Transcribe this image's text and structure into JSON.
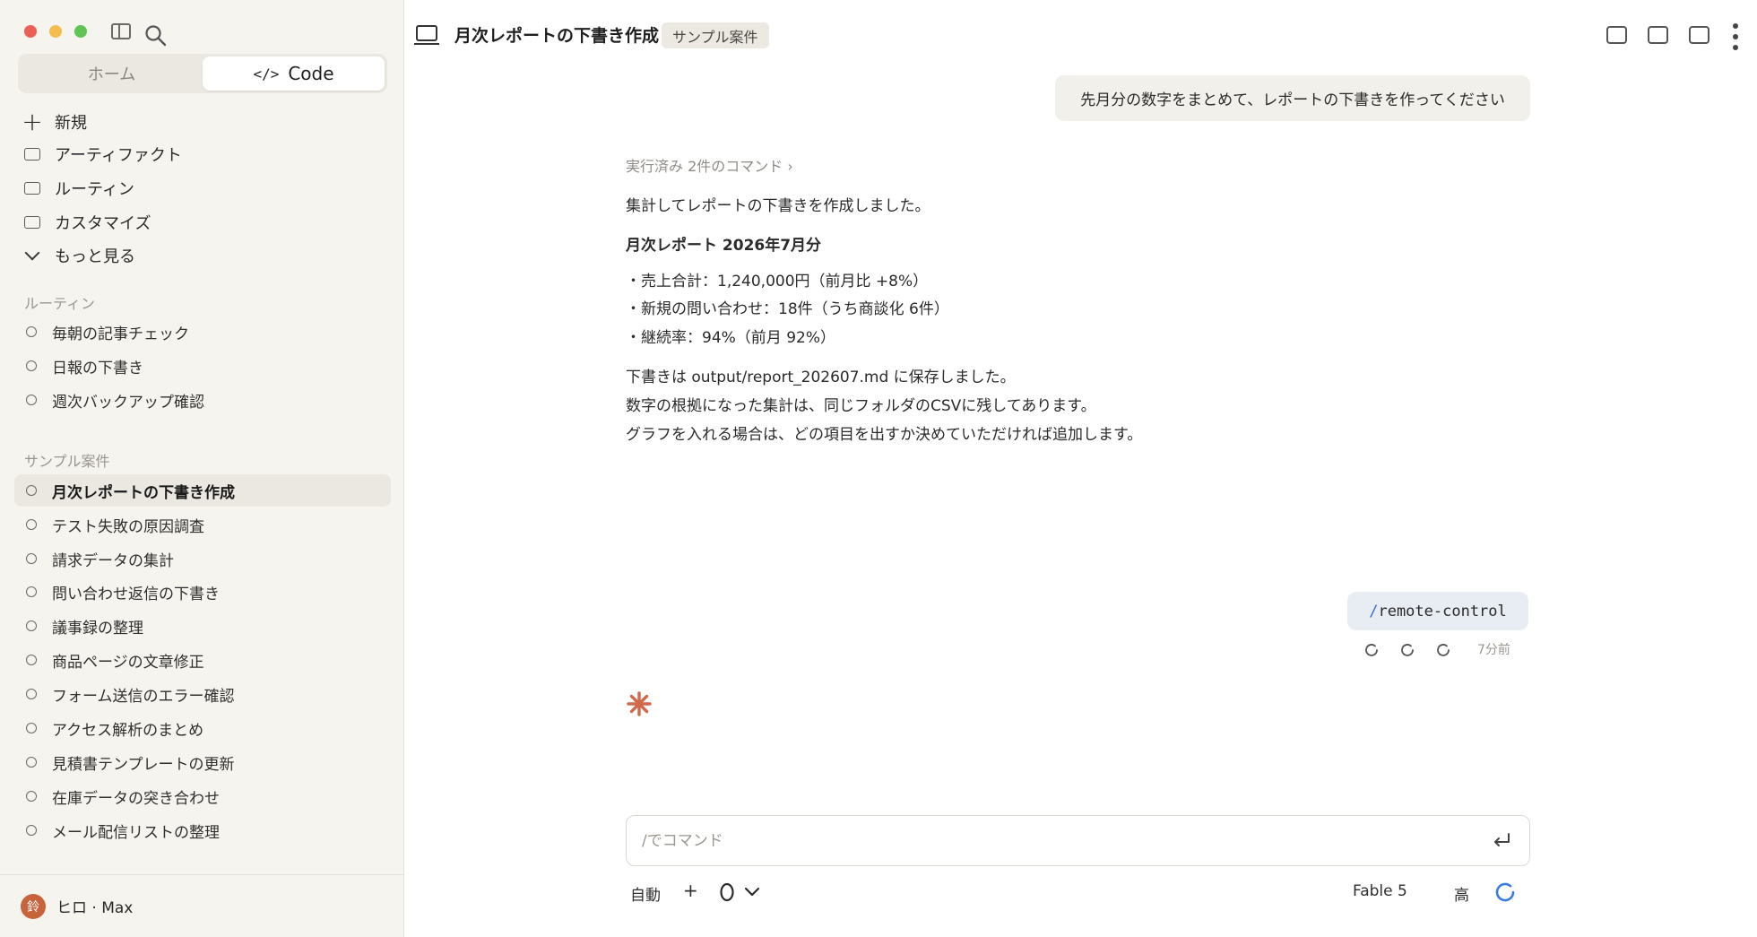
{
  "sidebar": {
    "mode_tabs": [
      {
        "label": "ホーム",
        "glyph": ""
      },
      {
        "label": "Code",
        "glyph": "</>"
      }
    ],
    "nav": [
      {
        "label": "新規",
        "icon": "plus-icon"
      },
      {
        "label": "アーティファクト",
        "icon": "artifact-icon"
      },
      {
        "label": "ルーティン",
        "icon": "routine-icon"
      },
      {
        "label": "カスタマイズ",
        "icon": "customize-icon"
      },
      {
        "label": "もっと見る",
        "icon": "chevron-down-icon"
      }
    ],
    "routines_label": "ルーティン",
    "routines": [
      "毎朝の記事チェック",
      "日報の下書き",
      "週次バックアップ確認"
    ],
    "projects_label": "サンプル案件",
    "projects": [
      "月次レポートの下書き作成",
      "テスト失敗の原因調査",
      "請求データの集計",
      "問い合わせ返信の下書き",
      "議事録の整理",
      "商品ページの文章修正",
      "フォーム送信のエラー確認",
      "アクセス解析のまとめ",
      "見積書テンプレートの更新",
      "在庫データの突き合わせ",
      "メール配信リストの整理"
    ],
    "active_project_index": 0,
    "user": {
      "avatar_text": "鈴",
      "name": "ヒロ · Max"
    }
  },
  "header": {
    "title": "月次レポートの下書き作成",
    "tag": "サンプル案件"
  },
  "conversation": {
    "user_message_1": "先月分の数字をまとめて、レポートの下書きを作ってください",
    "command_summary": "実行済み 2件のコマンド ›",
    "response_intro": "集計してレポートの下書きを作成しました。",
    "report_heading": "月次レポート 2026年7月分",
    "bullets": [
      "・売上合計：1,240,000円（前月比 +8%）",
      "・新規の問い合わせ：18件（うち商談化 6件）",
      "・継続率：94%（前月 92%）"
    ],
    "notes": [
      "下書きは output/report_202607.md に保存しました。",
      "数字の根拠になった集計は、同じフォルダのCSVに残してあります。",
      "グラフを入れる場合は、どの項目を出すか決めていただければ追加します。"
    ],
    "user_message_2_slash": "/",
    "user_message_2_cmd": "remote-control",
    "message_time": "7分前"
  },
  "composer": {
    "placeholder": "/でコマンド",
    "mode_label": "自動",
    "add_label": "+",
    "model": "Fable 5",
    "effort": "高"
  },
  "colors": {
    "accent": "#c8643c",
    "sidebar_bg": "#f6f4ef",
    "slash_blue": "#3a6bc8"
  }
}
